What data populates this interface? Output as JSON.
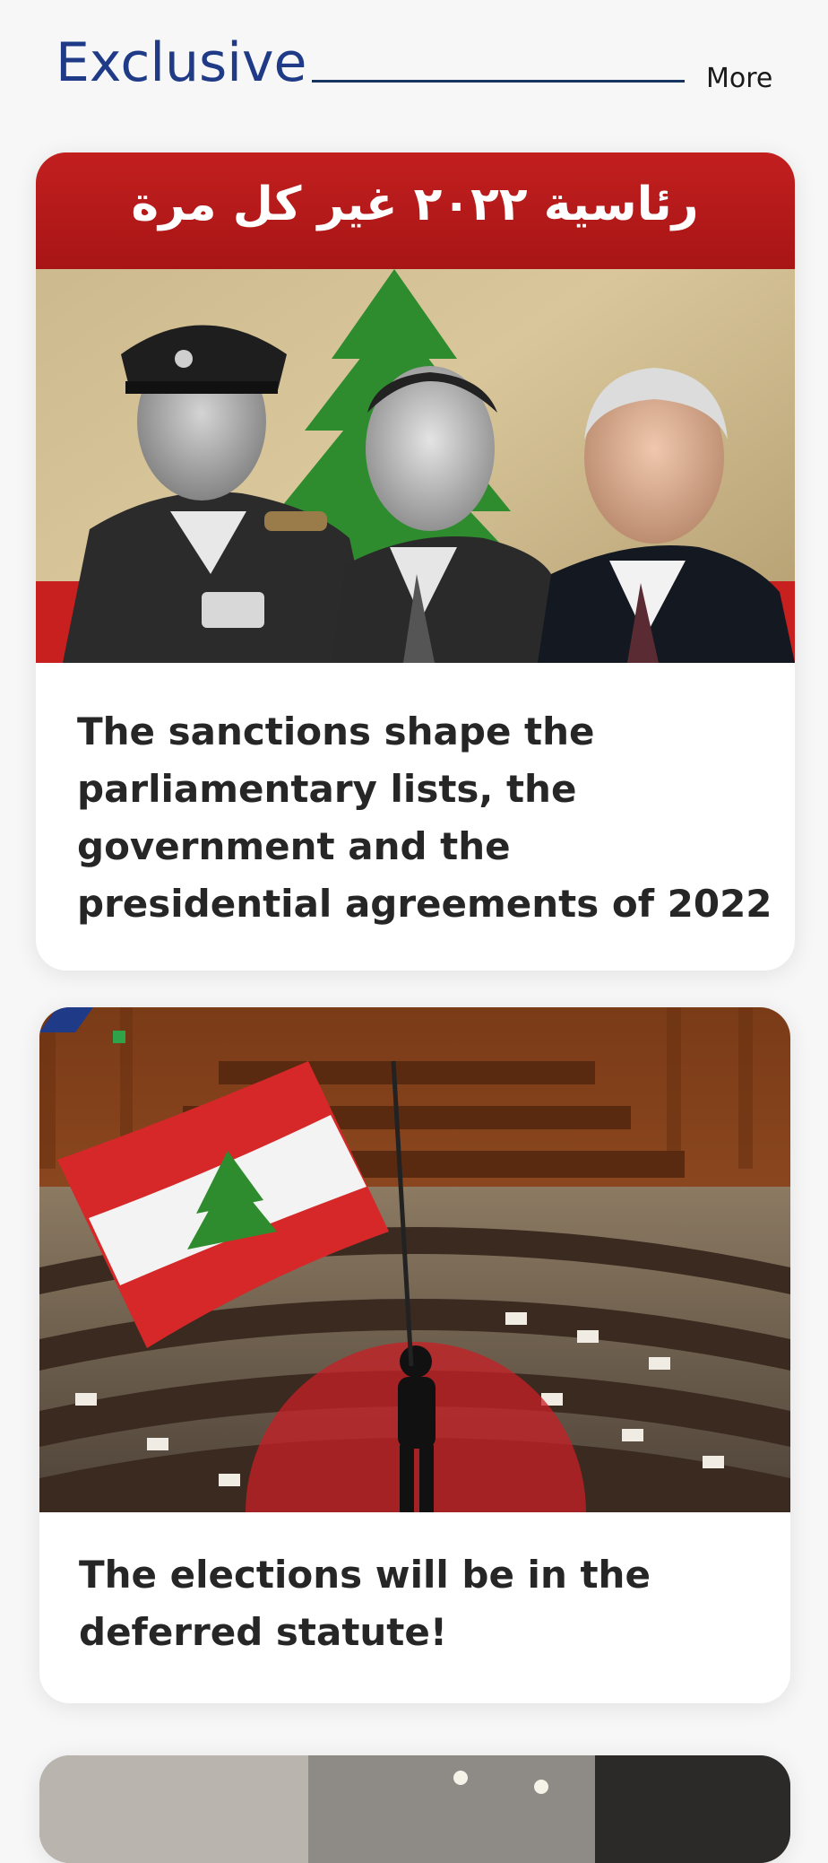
{
  "section": {
    "title": "Exclusive",
    "more_label": "More"
  },
  "articles": [
    {
      "image_overlay_text": "رئاسية ٢٠٢٢ غير كل مرة",
      "image_subject": "three-presidents-portrait",
      "headline": "The sanctions shape the parliamentary lists, the government and the presidential agreements of 2022"
    },
    {
      "image_subject": "lebanese-parliament-session-with-flag",
      "headline": "The elections will be in the deferred statute!"
    },
    {
      "image_subject": "interior-photo"
    }
  ],
  "colors": {
    "accent": "#1f3a86",
    "rule": "#16345f",
    "headline_text": "#262626",
    "flag_red": "#d62828",
    "cedar_green": "#2e8b2e"
  }
}
